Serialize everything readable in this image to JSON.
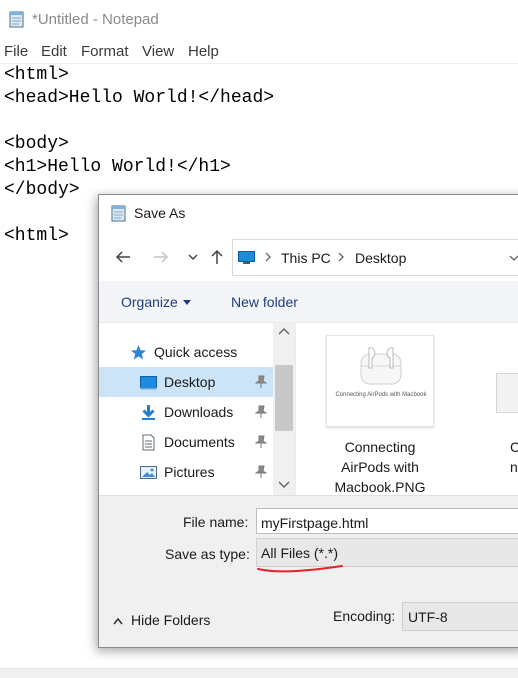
{
  "notepad": {
    "title": "*Untitled - Notepad",
    "menu": [
      "File",
      "Edit",
      "Format",
      "View",
      "Help"
    ],
    "lines": [
      "<html>",
      "<head>Hello World!</head>",
      "",
      "<body>",
      "<h1>Hello World!</h1>",
      "</body>",
      "",
      "<html>"
    ]
  },
  "dialog": {
    "title": "Save As",
    "address": [
      "This PC",
      "Desktop"
    ],
    "toolbar": {
      "organize": "Organize",
      "new_folder": "New folder"
    },
    "nav": [
      {
        "label": "Quick access",
        "icon": "star-icon"
      },
      {
        "label": "Desktop",
        "icon": "desktop-folder-icon",
        "selected": true,
        "pinned": true
      },
      {
        "label": "Downloads",
        "icon": "download-arrow-icon",
        "pinned": true
      },
      {
        "label": "Documents",
        "icon": "documents-icon",
        "pinned": true
      },
      {
        "label": "Pictures",
        "icon": "pictures-icon",
        "pinned": true
      }
    ],
    "files": [
      {
        "name": "Connecting AirPods with Macbook.PNG",
        "name_lines": [
          "Connecting",
          "AirPods with",
          "Macbook.PNG"
        ],
        "thumb_caption": "Connecting AirPods with Macbook"
      },
      {
        "name_fragment": "C\nn"
      }
    ],
    "file_name_label": "File name:",
    "file_name_value": "myFirstpage.html",
    "save_type_label": "Save as type:",
    "save_type_value": "All Files  (*.*)",
    "hide_folders": "Hide Folders",
    "encoding_label": "Encoding:",
    "encoding_value": "UTF-8",
    "annotation_color": "#e8202a",
    "accent_color": "#0078d7"
  }
}
